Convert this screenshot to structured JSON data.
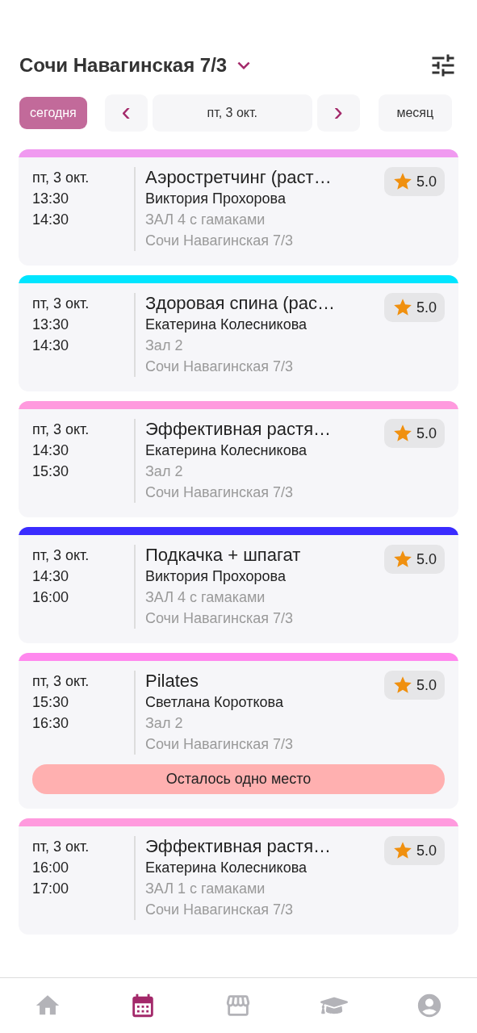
{
  "header": {
    "title": "Сочи Навагинская 7/3"
  },
  "toolbar": {
    "today": "сегодня",
    "prev": "‹",
    "date": "пт, 3 окт.",
    "next": "›",
    "view": "месяц"
  },
  "classes": [
    {
      "color": "#f09af0",
      "date": "пт, 3 окт.",
      "start": "13:30",
      "end": "14:30",
      "title": "Аэростретчинг (раст…",
      "trainer": "Виктория Прохорова",
      "room": "ЗАЛ 4 с гамаками",
      "address": "Сочи Навагинская 7/3",
      "rating": "5.0"
    },
    {
      "color": "#00e5ff",
      "date": "пт, 3 окт.",
      "start": "13:30",
      "end": "14:30",
      "title": "Здоровая спина (рас…",
      "trainer": "Екатерина Колесникова",
      "room": "Зал 2",
      "address": "Сочи Навагинская 7/3",
      "rating": "5.0"
    },
    {
      "color": "#ff9ade",
      "date": "пт, 3 окт.",
      "start": "14:30",
      "end": "15:30",
      "title": "Эффективная растя…",
      "trainer": "Екатерина Колесникова",
      "room": "Зал 2",
      "address": "Сочи Навагинская 7/3",
      "rating": "5.0"
    },
    {
      "color": "#3a2cff",
      "date": "пт, 3 окт.",
      "start": "14:30",
      "end": "16:00",
      "title": "Подкачка + шпагат",
      "trainer": "Виктория Прохорова",
      "room": "ЗАЛ 4 с гамаками",
      "address": "Сочи Навагинская 7/3",
      "rating": "5.0"
    },
    {
      "color": "#ff88ee",
      "date": "пт, 3 окт.",
      "start": "15:30",
      "end": "16:30",
      "title": "Pilates",
      "trainer": "Светлана Короткова",
      "room": "Зал 2",
      "address": "Сочи Навагинская 7/3",
      "rating": "5.0",
      "notice": "Осталось одно место"
    },
    {
      "color": "#ff9ade",
      "date": "пт, 3 окт.",
      "start": "16:00",
      "end": "17:00",
      "title": "Эффективная растя…",
      "trainer": "Екатерина Колесникова",
      "room": "ЗАЛ 1 с гамаками",
      "address": "Сочи Навагинская 7/3",
      "rating": "5.0"
    }
  ],
  "nav": [
    {
      "kind": "home",
      "selected": false
    },
    {
      "kind": "calendar",
      "selected": true
    },
    {
      "kind": "store",
      "selected": false
    },
    {
      "kind": "courses",
      "selected": false
    },
    {
      "kind": "profile",
      "selected": false
    }
  ]
}
